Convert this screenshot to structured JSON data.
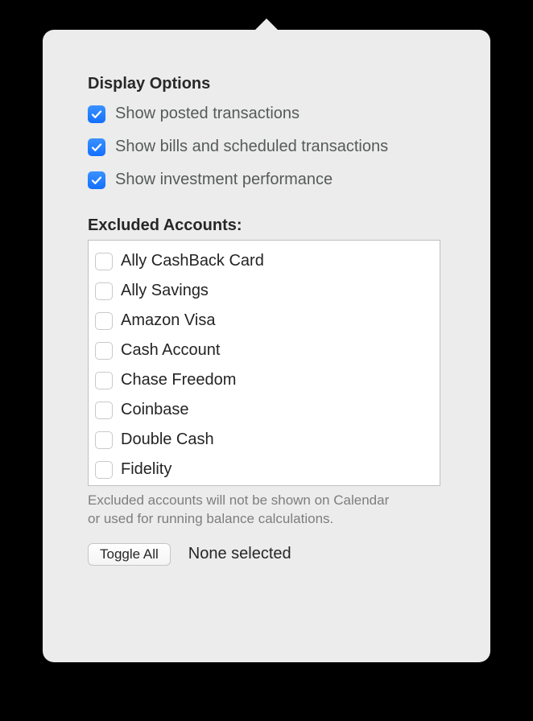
{
  "displayOptions": {
    "title": "Display Options",
    "items": [
      {
        "label": "Show posted transactions",
        "checked": true
      },
      {
        "label": "Show bills and scheduled transactions",
        "checked": true
      },
      {
        "label": "Show investment performance",
        "checked": true
      }
    ]
  },
  "excluded": {
    "title": "Excluded Accounts:",
    "accounts": [
      {
        "label": "Ally CashBack Card",
        "checked": false
      },
      {
        "label": "Ally Savings",
        "checked": false
      },
      {
        "label": "Amazon Visa",
        "checked": false
      },
      {
        "label": "Cash Account",
        "checked": false
      },
      {
        "label": "Chase Freedom",
        "checked": false
      },
      {
        "label": "Coinbase",
        "checked": false
      },
      {
        "label": "Double Cash",
        "checked": false
      },
      {
        "label": "Fidelity",
        "checked": false
      }
    ],
    "note": "Excluded accounts will not be shown on Calendar or used for running balance calculations.",
    "toggleAll": "Toggle All",
    "status": "None selected"
  }
}
